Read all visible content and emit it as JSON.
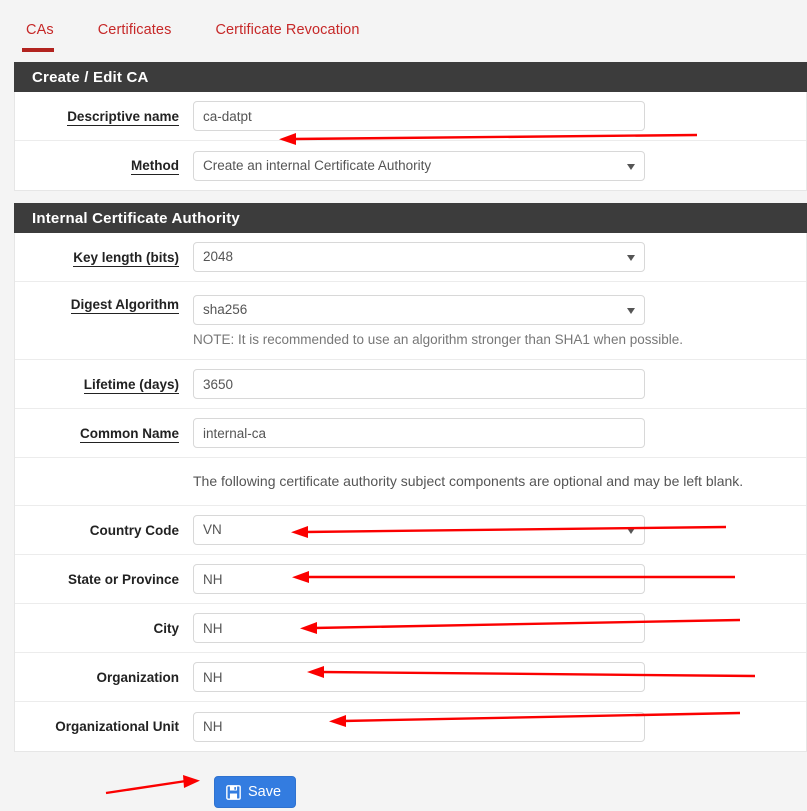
{
  "tabs": [
    {
      "label": "CAs",
      "active": true
    },
    {
      "label": "Certificates",
      "active": false
    },
    {
      "label": "Certificate Revocation",
      "active": false
    }
  ],
  "panels": {
    "create_edit": {
      "title": "Create / Edit CA",
      "fields": {
        "descriptive_name": {
          "label": "Descriptive name",
          "value": "ca-datpt"
        },
        "method": {
          "label": "Method",
          "value": "Create an internal Certificate Authority"
        }
      }
    },
    "internal_ca": {
      "title": "Internal Certificate Authority",
      "fields": {
        "key_length": {
          "label": "Key length (bits)",
          "value": "2048"
        },
        "digest_algorithm": {
          "label": "Digest Algorithm",
          "value": "sha256",
          "note": "NOTE: It is recommended to use an algorithm stronger than SHA1 when possible."
        },
        "lifetime": {
          "label": "Lifetime (days)",
          "value": "3650"
        },
        "common_name": {
          "label": "Common Name",
          "value": "internal-ca"
        },
        "optional_note": "The following certificate authority subject components are optional and may be left blank.",
        "country_code": {
          "label": "Country Code",
          "value": "VN"
        },
        "state_or_province": {
          "label": "State or Province",
          "value": "NH"
        },
        "city": {
          "label": "City",
          "value": "NH"
        },
        "organization": {
          "label": "Organization",
          "value": "NH"
        },
        "organizational_unit": {
          "label": "Organizational Unit",
          "value": "NH"
        }
      }
    }
  },
  "footer": {
    "save_label": "Save",
    "save_icon": "floppy-save-icon"
  },
  "colors": {
    "tab_red": "#c62828",
    "tab_underline": "#b2231f",
    "panel_header_bg": "#3c3c3c",
    "save_button_bg": "#337ce0",
    "annotation_arrow": "#fb0000",
    "page_bg": "#f4f4f4"
  },
  "annotations": {
    "type": "red-arrow",
    "count": 7,
    "targets": [
      "descriptive_name",
      "country_code",
      "state_or_province",
      "city",
      "organization",
      "organizational_unit",
      "save_button"
    ]
  }
}
